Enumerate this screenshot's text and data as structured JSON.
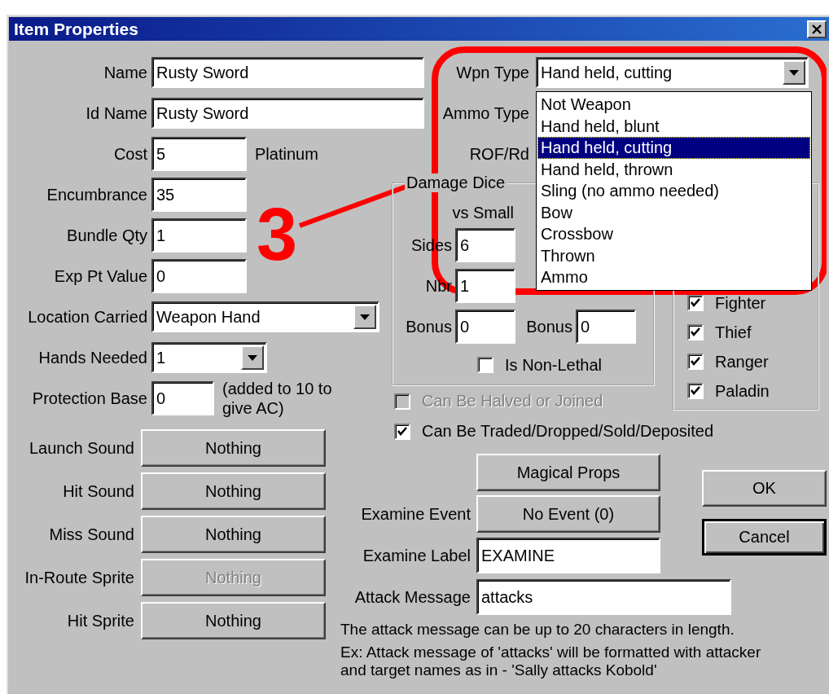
{
  "window": {
    "title": "Item Properties"
  },
  "fields": [
    {
      "label": "Name",
      "value": "Rusty Sword",
      "kind": "long-text"
    },
    {
      "label": "Id Name",
      "value": "Rusty Sword",
      "kind": "long-text"
    },
    {
      "label": "Cost",
      "value": "5",
      "kind": "short-text",
      "unit": "Platinum"
    },
    {
      "label": "Encumbrance",
      "value": "35",
      "kind": "short-text"
    },
    {
      "label": "Bundle Qty",
      "value": "1",
      "kind": "short-text"
    },
    {
      "label": "Exp Pt Value",
      "value": "0",
      "kind": "short-text"
    },
    {
      "label": "Location Carried",
      "value": "Weapon Hand",
      "kind": "wide-combo"
    },
    {
      "label": "Hands Needed",
      "value": "1",
      "kind": "narrow-combo"
    },
    {
      "label": "Protection Base",
      "value": "0",
      "kind": "tiny-text",
      "note": "(added to 10 to give AC)"
    }
  ],
  "sounds": [
    {
      "label": "Launch Sound",
      "value": "Nothing",
      "disabled": false
    },
    {
      "label": "Hit Sound",
      "value": "Nothing",
      "disabled": false
    },
    {
      "label": "Miss Sound",
      "value": "Nothing",
      "disabled": false
    },
    {
      "label": "In-Route Sprite",
      "value": "Nothing",
      "disabled": true
    },
    {
      "label": "Hit Sprite",
      "value": "Nothing",
      "disabled": false
    }
  ],
  "weapon": {
    "label": "Wpn Type",
    "value": "Hand held, cutting",
    "options": [
      {
        "label": "Not Weapon",
        "selected": false
      },
      {
        "label": "Hand held, blunt",
        "selected": false
      },
      {
        "label": "Hand held, cutting",
        "selected": true
      },
      {
        "label": "Hand held, thrown",
        "selected": false
      },
      {
        "label": "Sling (no ammo needed)",
        "selected": false
      },
      {
        "label": "Bow",
        "selected": false
      },
      {
        "label": "Crossbow",
        "selected": false
      },
      {
        "label": "Thrown",
        "selected": false
      },
      {
        "label": "Ammo",
        "selected": false
      }
    ]
  },
  "covered_labels": [
    "Ammo Type",
    "ROF/Rd"
  ],
  "damage_dice": {
    "title": "Damage Dice",
    "columns": [
      {
        "heading": "vs Small",
        "rows": [
          {
            "label": "Sides",
            "value": "6"
          },
          {
            "label": "Nbr",
            "value": "1"
          },
          {
            "label": "Bonus",
            "value": "0"
          }
        ]
      },
      {
        "rows": [
          {
            "label": "Bonus",
            "value": "0"
          }
        ]
      }
    ],
    "non_lethal": {
      "label": "Is Non-Lethal",
      "checked": false
    }
  },
  "classes": [
    {
      "label": "Fighter",
      "checked": true
    },
    {
      "label": "Thief",
      "checked": true
    },
    {
      "label": "Ranger",
      "checked": true
    },
    {
      "label": "Paladin",
      "checked": true
    }
  ],
  "options": [
    {
      "label": "Can Be Halved or Joined",
      "checked": false,
      "disabled": true
    },
    {
      "label": "Can Be Traded/Dropped/Sold/Deposited",
      "checked": true,
      "disabled": false
    }
  ],
  "magic_button": "Magical Props",
  "examine_event": {
    "label": "Examine Event",
    "button": "No Event (0)"
  },
  "examine_label": {
    "label": "Examine Label",
    "value": "EXAMINE"
  },
  "attack_message": {
    "label": "Attack Message",
    "value": "attacks"
  },
  "notes": [
    "The attack message can be up to 20 characters in length.",
    "Ex: Attack message of 'attacks' will be formatted with attacker and target names as in - 'Sally attacks Kobold'"
  ],
  "buttons": [
    {
      "label": "OK",
      "default": false
    },
    {
      "label": "Cancel",
      "default": true
    }
  ],
  "annotation": {
    "label": "3"
  }
}
